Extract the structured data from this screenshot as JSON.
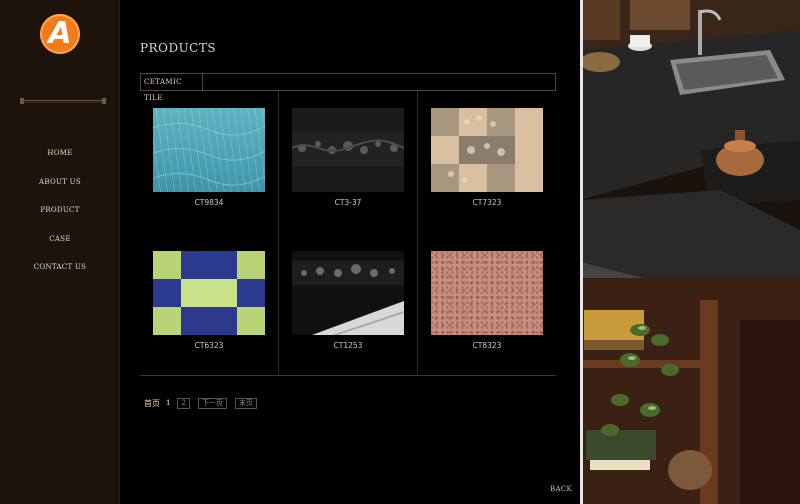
{
  "brand": {
    "logo_letter": "A",
    "accent": "#f27a1a"
  },
  "nav": {
    "items": [
      {
        "label": "HOME"
      },
      {
        "label": "ABOUT US"
      },
      {
        "label": "PRODUCT"
      },
      {
        "label": "CASE"
      },
      {
        "label": "CONTACT US"
      }
    ]
  },
  "main": {
    "title": "PRODUCTS",
    "category_tab": "CETAMIC TILE",
    "products": [
      {
        "code": "CT9834",
        "pattern": "teal-wave-tile"
      },
      {
        "code": "CT3-37",
        "pattern": "black-floral-border-tile"
      },
      {
        "code": "CT7323",
        "pattern": "beige-checker-floral-tile"
      },
      {
        "code": "CT6323",
        "pattern": "green-blue-checker-tile"
      },
      {
        "code": "CT1253",
        "pattern": "black-floral-border-with-white-floor"
      },
      {
        "code": "CT8323",
        "pattern": "pink-granite-tile"
      }
    ],
    "pagination": {
      "first": "首页",
      "current": "1",
      "page2": "2",
      "next": "下一页",
      "last": "末页"
    },
    "back": "BACK"
  },
  "photo": {
    "subject": "kitchen-counter-photo"
  }
}
